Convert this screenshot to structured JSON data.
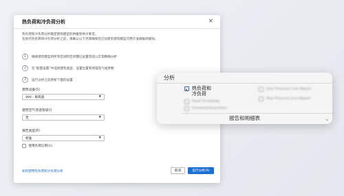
{
  "dialog": {
    "title": "热负荷和冷负荷分析",
    "close_glyph": "×",
    "intro_line1": "热负荷和冷负荷分析确定建筑模型的供暖和供冷要求。",
    "intro_line2": "在执行热负荷和冷负荷分析之前，请确认以下步骤确保您已创建的建筑模型可用于准确能耗模拟。",
    "steps": [
      {
        "num": "1",
        "text": "确保建筑模型的所有区域和空间都已设置完成以实现精确分析"
      },
      {
        "num": "2",
        "text": "在“能量设置”中选择建筑类型、设置位置和地理及气候参数"
      },
      {
        "num": "3",
        "text": "运行分析之前更新下面的设置"
      }
    ],
    "building_service_label": "建筑设备(S)",
    "building_service_value": "VAV - 单风道",
    "outdoor_air_label": "建筑空气渗透等级(I)",
    "outdoor_air_value": "无",
    "report_type_label": "报告类型(R)",
    "report_type_value": "标准",
    "checkbox_label": "使用负荷信用(U)",
    "help_link": "如何使用热负荷和冷负荷分析",
    "cancel_label": "取消",
    "run_label": "运行分析(R)"
  },
  "ribbon": {
    "tab_label": "分析",
    "main_item": "热负荷和冷负荷",
    "blurred_items": [
      "Panel Schedules",
      "Schedule/Quantities",
      "Duct Pressure Loss Report",
      "Pipe Pressure Loss Report"
    ],
    "group_label": "报告和明细表",
    "corner_glyph": "↘"
  }
}
